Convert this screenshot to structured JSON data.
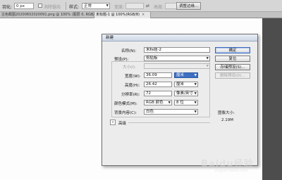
{
  "options_bar": {
    "feather_label": "羽化:",
    "feather_value": "0 px",
    "antialias_label": "消除锯齿",
    "style_label": "样式:",
    "style_value": "正常",
    "width_label": "宽度:",
    "height_label": "高度:",
    "refine_edge_label": "调整边缘..."
  },
  "tabs": [
    {
      "label": "古色截图20200602020091.png @ 100% (图层 0, RGB/8)",
      "close": "×",
      "active": false
    },
    {
      "label": "未标题-1 @ 100%(RGB/8)",
      "close": "×",
      "active": true
    }
  ],
  "dialog": {
    "title": "新建",
    "name_label": "名称(N):",
    "name_value": "未标题-2",
    "preset_label": "预设(P):",
    "preset_value": "剪贴板",
    "size_label": "大小(I):",
    "width_label": "宽度(W):",
    "width_value": "36.09",
    "width_unit": "厘米",
    "height_label": "高度(H):",
    "height_value": "26.42",
    "height_unit": "厘米",
    "resolution_label": "分辨率(R):",
    "resolution_value": "72",
    "resolution_unit": "像素/英寸",
    "color_mode_label": "颜色模式(M):",
    "color_mode_value": "RGB 颜色",
    "bit_depth_value": "8 位",
    "background_label": "背景内容(C):",
    "background_value": "白色",
    "advanced_label": "高级",
    "buttons": {
      "ok": "确定",
      "reset": "复位",
      "save_preset": "存储预设(S)...",
      "delete_preset": "删除预设(D)..."
    },
    "image_size_label": "图像大小:",
    "image_size_value": "2.19M"
  },
  "watermark": {
    "text": "Baidu经验",
    "sub": "jingyan.baidu.com"
  }
}
